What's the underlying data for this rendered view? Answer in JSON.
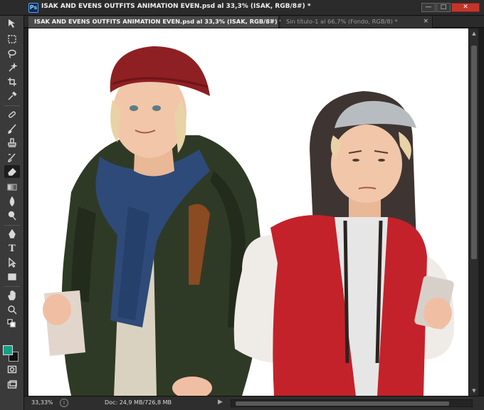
{
  "window": {
    "title": "ISAK AND EVENS OUTFITS ANIMATION EVEN.psd al 33,3% (ISAK, RGB/8#) *",
    "app_icon_text": "Ps",
    "minimize_glyph": "—",
    "maximize_glyph": "□",
    "close_glyph": "✕"
  },
  "tabs": [
    {
      "label": "ISAK AND EVENS OUTFITS ANIMATION EVEN.psd al 33,3% (ISAK, RGB/8#) *",
      "close": "×",
      "active": true
    },
    {
      "label": "Sin título-1 al 66,7% (Fondo, RGB/8) *",
      "close": "×",
      "active": false
    }
  ],
  "tools": [
    {
      "name": "move-tool-icon"
    },
    {
      "name": "marquee-tool-icon"
    },
    {
      "name": "lasso-tool-icon"
    },
    {
      "name": "magic-wand-tool-icon"
    },
    {
      "name": "crop-tool-icon"
    },
    {
      "name": "eyedropper-tool-icon"
    },
    {
      "name": "healing-brush-tool-icon"
    },
    {
      "name": "brush-tool-icon"
    },
    {
      "name": "clone-stamp-tool-icon"
    },
    {
      "name": "history-brush-tool-icon"
    },
    {
      "name": "eraser-tool-icon",
      "active": true
    },
    {
      "name": "gradient-tool-icon"
    },
    {
      "name": "blur-tool-icon"
    },
    {
      "name": "dodge-tool-icon"
    },
    {
      "name": "pen-tool-icon"
    },
    {
      "name": "type-tool-icon",
      "glyph": "T"
    },
    {
      "name": "path-selection-tool-icon"
    },
    {
      "name": "shape-tool-icon"
    },
    {
      "name": "hand-tool-icon"
    },
    {
      "name": "zoom-tool-icon"
    }
  ],
  "colors": {
    "foreground": "#12a184",
    "background": "#111111",
    "isak_beanie": "#8e1f23",
    "isak_jacket": "#2f3a26",
    "isak_scarf": "#2e4a78",
    "even_hood": "#3e3532",
    "even_vest": "#c4222a",
    "skin": "#f2c6a8",
    "hair": "#e8d2a6"
  },
  "status": {
    "zoom": "33,33%",
    "doc_info": "Doc: 24,9 MB/726,8 MB",
    "arrow_glyph": "▶"
  }
}
